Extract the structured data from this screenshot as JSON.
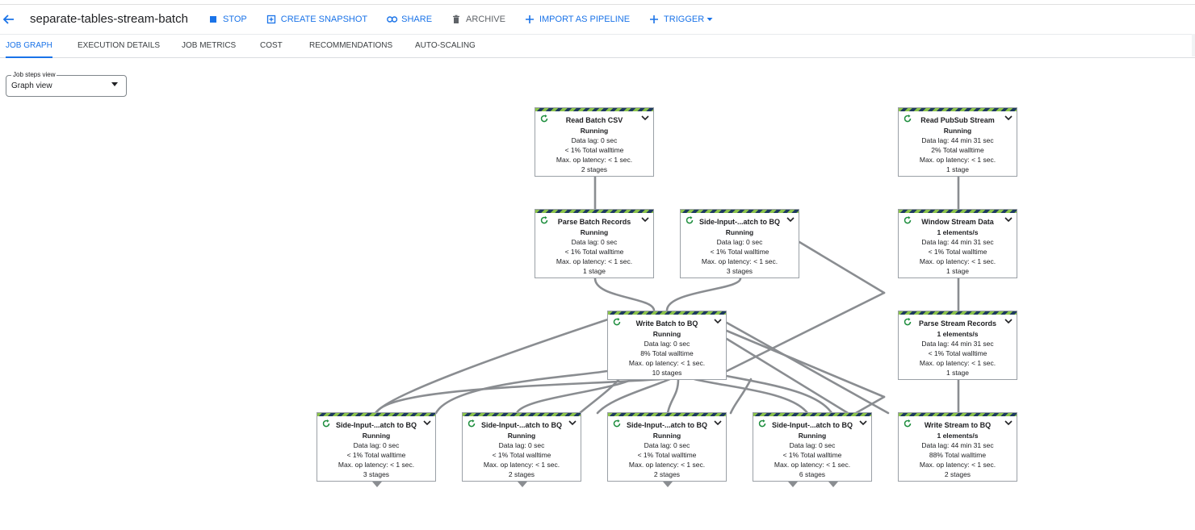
{
  "header": {
    "title": "separate-tables-stream-batch",
    "actions": [
      {
        "label": "STOP",
        "icon": "stop-icon"
      },
      {
        "label": "CREATE SNAPSHOT",
        "icon": "snapshot-icon"
      },
      {
        "label": "SHARE",
        "icon": "link-icon"
      },
      {
        "label": "ARCHIVE",
        "icon": "trash-icon"
      },
      {
        "label": "IMPORT AS PIPELINE",
        "icon": "plus-icon"
      },
      {
        "label": "TRIGGER",
        "icon": "plus-icon"
      }
    ]
  },
  "tabs": [
    "JOB GRAPH",
    "EXECUTION DETAILS",
    "JOB METRICS",
    "COST",
    "RECOMMENDATIONS",
    "AUTO-SCALING"
  ],
  "active_tab": "JOB GRAPH",
  "steps_view": {
    "label": "Job steps view",
    "value": "Graph view"
  },
  "colors": {
    "accent": "#1a73e8",
    "running_green": "#1e8e3e",
    "stripe_green": "#8bc34a",
    "stripe_navy": "#1e3a5f",
    "edge": "#80868b"
  },
  "nodes": [
    {
      "id": "read-batch-csv",
      "name": "Read Batch CSV",
      "status": "Running",
      "lines": [
        "Data lag: 0 sec",
        "< 1% Total walltime",
        "Max. op latency: < 1 sec.",
        "2 stages"
      ]
    },
    {
      "id": "read-pubsub-stream",
      "name": "Read PubSub Stream",
      "status": "Running",
      "lines": [
        "Data lag: 44 min 31 sec",
        "2% Total walltime",
        "Max. op latency: < 1 sec.",
        "1 stage"
      ]
    },
    {
      "id": "parse-batch-records",
      "name": "Parse Batch Records",
      "status": "Running",
      "lines": [
        "Data lag: 0 sec",
        "< 1% Total walltime",
        "Max. op latency: < 1 sec.",
        "1 stage"
      ]
    },
    {
      "id": "side-input-top",
      "name": "Side-Input-...atch to BQ",
      "status": "Running",
      "lines": [
        "Data lag: 0 sec",
        "< 1% Total walltime",
        "Max. op latency: < 1 sec.",
        "3 stages"
      ]
    },
    {
      "id": "window-stream-data",
      "name": "Window Stream Data",
      "status": "1 elements/s",
      "lines": [
        "Data lag: 44 min 31 sec",
        "< 1% Total walltime",
        "Max. op latency: < 1 sec.",
        "1 stage"
      ]
    },
    {
      "id": "write-batch-to-bq",
      "name": "Write Batch to BQ",
      "status": "Running",
      "lines": [
        "Data lag: 0 sec",
        "8% Total walltime",
        "Max. op latency: < 1 sec.",
        "10 stages"
      ]
    },
    {
      "id": "parse-stream-records",
      "name": "Parse Stream Records",
      "status": "1 elements/s",
      "lines": [
        "Data lag: 44 min 31 sec",
        "< 1% Total walltime",
        "Max. op latency: < 1 sec.",
        "1 stage"
      ]
    },
    {
      "id": "side-input-1",
      "name": "Side-Input-...atch to BQ",
      "status": "Running",
      "lines": [
        "Data lag: 0 sec",
        "< 1% Total walltime",
        "Max. op latency: < 1 sec.",
        "3 stages"
      ]
    },
    {
      "id": "side-input-2",
      "name": "Side-Input-...atch to BQ",
      "status": "Running",
      "lines": [
        "Data lag: 0 sec",
        "< 1% Total walltime",
        "Max. op latency: < 1 sec.",
        "2 stages"
      ]
    },
    {
      "id": "side-input-3",
      "name": "Side-Input-...atch to BQ",
      "status": "Running",
      "lines": [
        "Data lag: 0 sec",
        "< 1% Total walltime",
        "Max. op latency: < 1 sec.",
        "2 stages"
      ]
    },
    {
      "id": "side-input-4",
      "name": "Side-Input-...atch to BQ",
      "status": "Running",
      "lines": [
        "Data lag: 0 sec",
        "< 1% Total walltime",
        "Max. op latency: < 1 sec.",
        "6 stages"
      ]
    },
    {
      "id": "write-stream-to-bq",
      "name": "Write Stream to BQ",
      "status": "1 elements/s",
      "lines": [
        "Data lag: 44 min 31 sec",
        "88% Total walltime",
        "Max. op latency: < 1 sec.",
        "2 stages"
      ]
    }
  ]
}
